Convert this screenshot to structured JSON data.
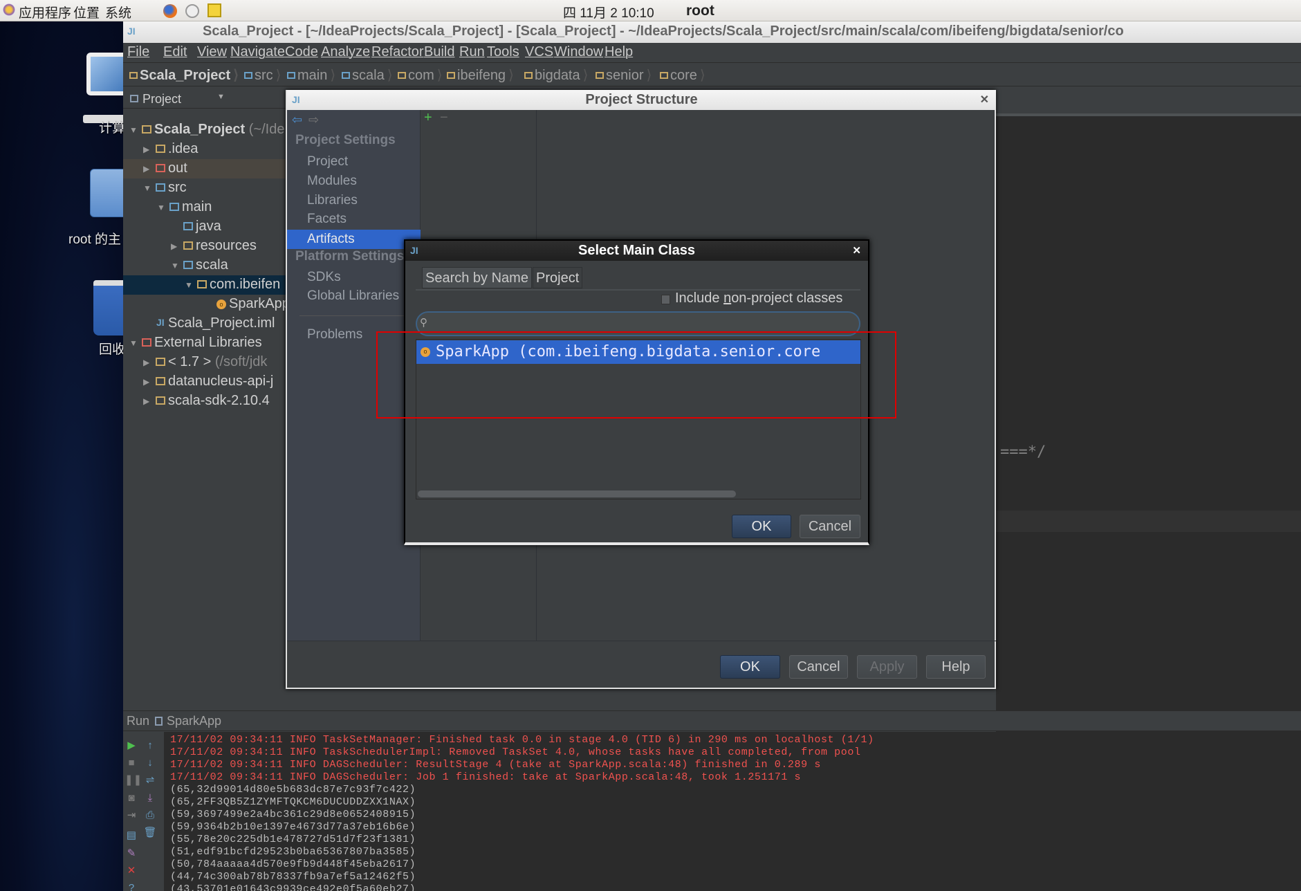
{
  "top_panel": {
    "menus": [
      "应用程序",
      "位置",
      "系统"
    ],
    "clock": "四 11月  2 10:10",
    "user": "root"
  },
  "desktop": {
    "icons": [
      {
        "label": "计算",
        "icon": "computer-icon"
      },
      {
        "label": "root 的主",
        "icon": "home-folder-icon"
      },
      {
        "label": "回收",
        "icon": "trash-icon"
      }
    ]
  },
  "ide": {
    "title": "Scala_Project - [~/IdeaProjects/Scala_Project] - [Scala_Project] - ~/IdeaProjects/Scala_Project/src/main/scala/com/ibeifeng/bigdata/senior/co",
    "menu": [
      "File",
      "Edit",
      "View",
      "Navigate",
      "Code",
      "Analyze",
      "Refactor",
      "Build",
      "Run",
      "Tools",
      "VCS",
      "Window",
      "Help"
    ],
    "breadcrumbs": [
      "Scala_Project",
      "src",
      "main",
      "scala",
      "com",
      "ibeifeng",
      "bigdata",
      "senior",
      "core"
    ],
    "project_panel": {
      "title": "Project",
      "tree": [
        {
          "label": "Scala_Project",
          "suffix": "(~/Ide",
          "level": 0,
          "state": "expanded",
          "icon": "module-folder-icon"
        },
        {
          "label": ".idea",
          "level": 1,
          "state": "collapsed",
          "icon": "folder-icon"
        },
        {
          "label": "out",
          "level": 1,
          "state": "collapsed",
          "icon": "excluded-folder-icon",
          "highlight": true
        },
        {
          "label": "src",
          "level": 1,
          "state": "expanded",
          "icon": "source-folder-icon"
        },
        {
          "label": "main",
          "level": 2,
          "state": "expanded",
          "icon": "source-folder-icon"
        },
        {
          "label": "java",
          "level": 3,
          "state": "leaf",
          "icon": "source-folder-icon"
        },
        {
          "label": "resources",
          "level": 3,
          "state": "collapsed",
          "icon": "resources-folder-icon"
        },
        {
          "label": "scala",
          "level": 3,
          "state": "expanded",
          "icon": "source-folder-icon"
        },
        {
          "label": "com.ibeifen",
          "level": 4,
          "state": "expanded",
          "icon": "package-icon",
          "selected": true
        },
        {
          "label": "SparkApp",
          "level": 5,
          "state": "leaf",
          "icon": "scala-object-icon"
        },
        {
          "label": "Scala_Project.iml",
          "level": 1,
          "state": "leaf",
          "icon": "iml-file-icon"
        },
        {
          "label": "External Libraries",
          "level": 0,
          "state": "expanded",
          "icon": "libraries-icon"
        },
        {
          "label": "< 1.7 >",
          "suffix": "(/soft/jdk",
          "level": 1,
          "state": "collapsed",
          "icon": "jdk-icon"
        },
        {
          "label": "datanucleus-api-j",
          "level": 1,
          "state": "collapsed",
          "icon": "library-icon"
        },
        {
          "label": "scala-sdk-2.10.4",
          "level": 1,
          "state": "collapsed",
          "icon": "library-icon"
        }
      ]
    },
    "editor_fragment": "===*/",
    "run_panel": {
      "label": "Run",
      "config": "SparkApp",
      "lines": [
        {
          "type": "err",
          "text": "17/11/02 09:34:11 INFO TaskSetManager: Finished task 0.0 in stage 4.0 (TID 6) in 290 ms on localhost (1/1)"
        },
        {
          "type": "err",
          "text": "17/11/02 09:34:11 INFO TaskSchedulerImpl: Removed TaskSet 4.0, whose tasks have all completed, from pool"
        },
        {
          "type": "err",
          "text": "17/11/02 09:34:11 INFO DAGScheduler: ResultStage 4 (take at SparkApp.scala:48) finished in 0.289 s"
        },
        {
          "type": "err",
          "text": "17/11/02 09:34:11 INFO DAGScheduler: Job 1 finished: take at SparkApp.scala:48, took 1.251171 s"
        },
        {
          "type": "out",
          "text": "(65,32d99014d80e5b683dc87e7c93f7c422)"
        },
        {
          "type": "out",
          "text": "(65,2FF3QB5Z1ZYMFTQKCM6DUCUDDZXX1NAX)"
        },
        {
          "type": "out",
          "text": "(59,3697499e2a4bc361c29d8e0652408915)"
        },
        {
          "type": "out",
          "text": "(59,9364b2b10e1397e4673d77a37eb16b6e)"
        },
        {
          "type": "out",
          "text": "(55,78e20c225db1e478727d51d7f23f1381)"
        },
        {
          "type": "out",
          "text": "(51,edf91bcfd29523b0ba65367807ba3585)"
        },
        {
          "type": "out",
          "text": "(50,784aaaaa4d570e9fb9d448f45eba2617)"
        },
        {
          "type": "out",
          "text": "(44,74c300ab78b78337fb9a7ef5a12462f5)"
        },
        {
          "type": "out",
          "text": "(43,53701e01643c9939ce492e0f5a60eb27)"
        }
      ]
    }
  },
  "project_structure": {
    "title": "Project Structure",
    "sections": [
      {
        "header": "Project Settings",
        "items": [
          "Project",
          "Modules",
          "Libraries",
          "Facets",
          "Artifacts"
        ]
      },
      {
        "header": "Platform Settings",
        "items": [
          "SDKs",
          "Global Libraries"
        ]
      }
    ],
    "problems": "Problems",
    "selected_item": "Artifacts",
    "buttons": {
      "ok": "OK",
      "cancel": "Cancel",
      "apply": "Apply",
      "help": "Help"
    }
  },
  "select_main_class": {
    "title": "Select Main Class",
    "tabs": [
      "Search by Name",
      "Project"
    ],
    "active_tab": "Search by Name",
    "include_checkbox": {
      "label_pre": "Include ",
      "label_mnemonic": "n",
      "label_post": "on-project classes",
      "checked": false
    },
    "search_value": "",
    "results": [
      "SparkApp  (com.ibeifeng.bigdata.senior.core"
    ],
    "buttons": {
      "ok": "OK",
      "cancel": "Cancel"
    }
  },
  "colors": {
    "selection": "#2f65ca",
    "highlight_box": "#e00000",
    "error_text": "#f0524f"
  }
}
